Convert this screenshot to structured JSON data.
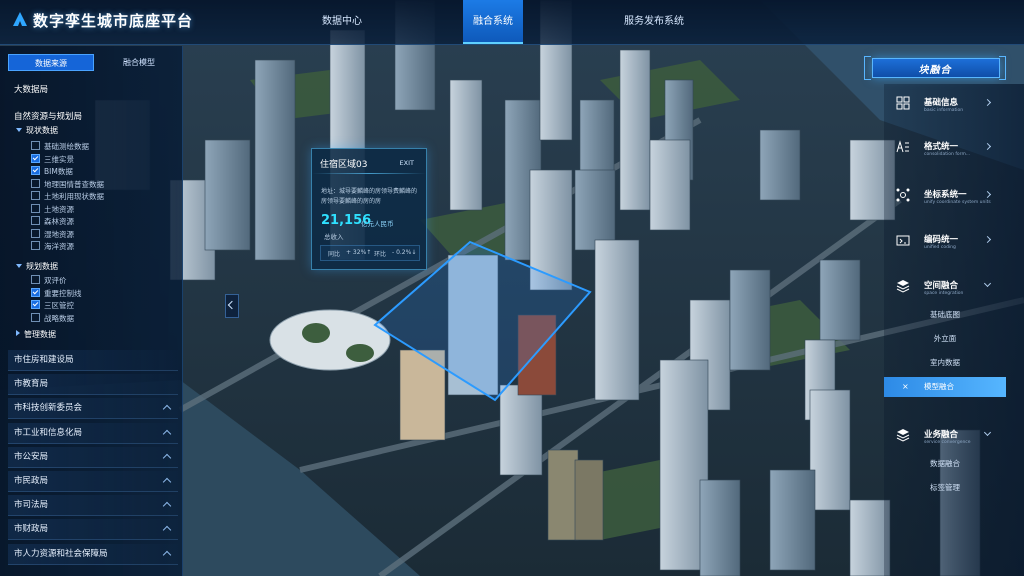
{
  "header": {
    "title": "数字孪生城市底座平台",
    "nav": [
      "数据中心",
      "融合系统",
      "服务发布系统"
    ],
    "active_nav": "融合系统"
  },
  "left_panel": {
    "tabs": [
      "数据来源",
      "融合模型"
    ],
    "active_tab": "数据来源",
    "big_data": "大数据局",
    "bureau": "自然资源与规划局",
    "current_group": {
      "label": "现状数据",
      "items": [
        {
          "label": "基础测绘数据",
          "checked": false
        },
        {
          "label": "三维实景",
          "checked": true
        },
        {
          "label": "BIM数据",
          "checked": true
        },
        {
          "label": "地理国情普查数据",
          "checked": false
        },
        {
          "label": "土地利用现状数据",
          "checked": false
        },
        {
          "label": "土地资源",
          "checked": false
        },
        {
          "label": "森林资源",
          "checked": false
        },
        {
          "label": "湿地资源",
          "checked": false
        },
        {
          "label": "海洋资源",
          "checked": false
        }
      ]
    },
    "plan_group": {
      "label": "规划数据",
      "items": [
        {
          "label": "双评价",
          "checked": false
        },
        {
          "label": "重要控制线",
          "checked": true
        },
        {
          "label": "三区管控",
          "checked": true
        },
        {
          "label": "战略数据",
          "checked": false
        }
      ]
    },
    "manage_group": "管理数据",
    "departments": [
      "市住房和建设局",
      "市教育局",
      "市科技创新委员会",
      "市工业和信息化局",
      "市公安局",
      "市民政局",
      "市司法局",
      "市财政局",
      "市人力资源和社会保障局"
    ]
  },
  "popup": {
    "title": "住宿区域03",
    "exit": "EXIT",
    "address": "地址：城导要麟峰的房领导费麟峰的房领导要麟峰的房的房",
    "value": "21,156",
    "unit": "亿元人民币",
    "label": "总收入",
    "yoy_label": "同比",
    "yoy_value": "+ 32%↑",
    "mom_label": "环比",
    "mom_value": "- 0.2%↓"
  },
  "right_panel": {
    "title": "块融合",
    "items": [
      {
        "name": "基础信息",
        "en": "basic information",
        "icon": "grid-icon"
      },
      {
        "name": "格式统一",
        "en": "consolidation form...",
        "icon": "format-icon"
      },
      {
        "name": "坐标系统一",
        "en": "unify coordinate system units",
        "icon": "coordinate-icon"
      },
      {
        "name": "编码统一",
        "en": "unified coding",
        "icon": "coding-icon"
      },
      {
        "name": "空间融合",
        "en": "space integration",
        "icon": "layers-icon"
      }
    ],
    "space_sub": [
      "基础底图",
      "外立面",
      "室内数据",
      "模型融合"
    ],
    "active_sub": "模型融合",
    "business": {
      "name": "业务融合",
      "en": "service convergence",
      "icon": "business-layers-icon"
    },
    "business_sub": [
      "数据融合",
      "标签管理"
    ]
  }
}
